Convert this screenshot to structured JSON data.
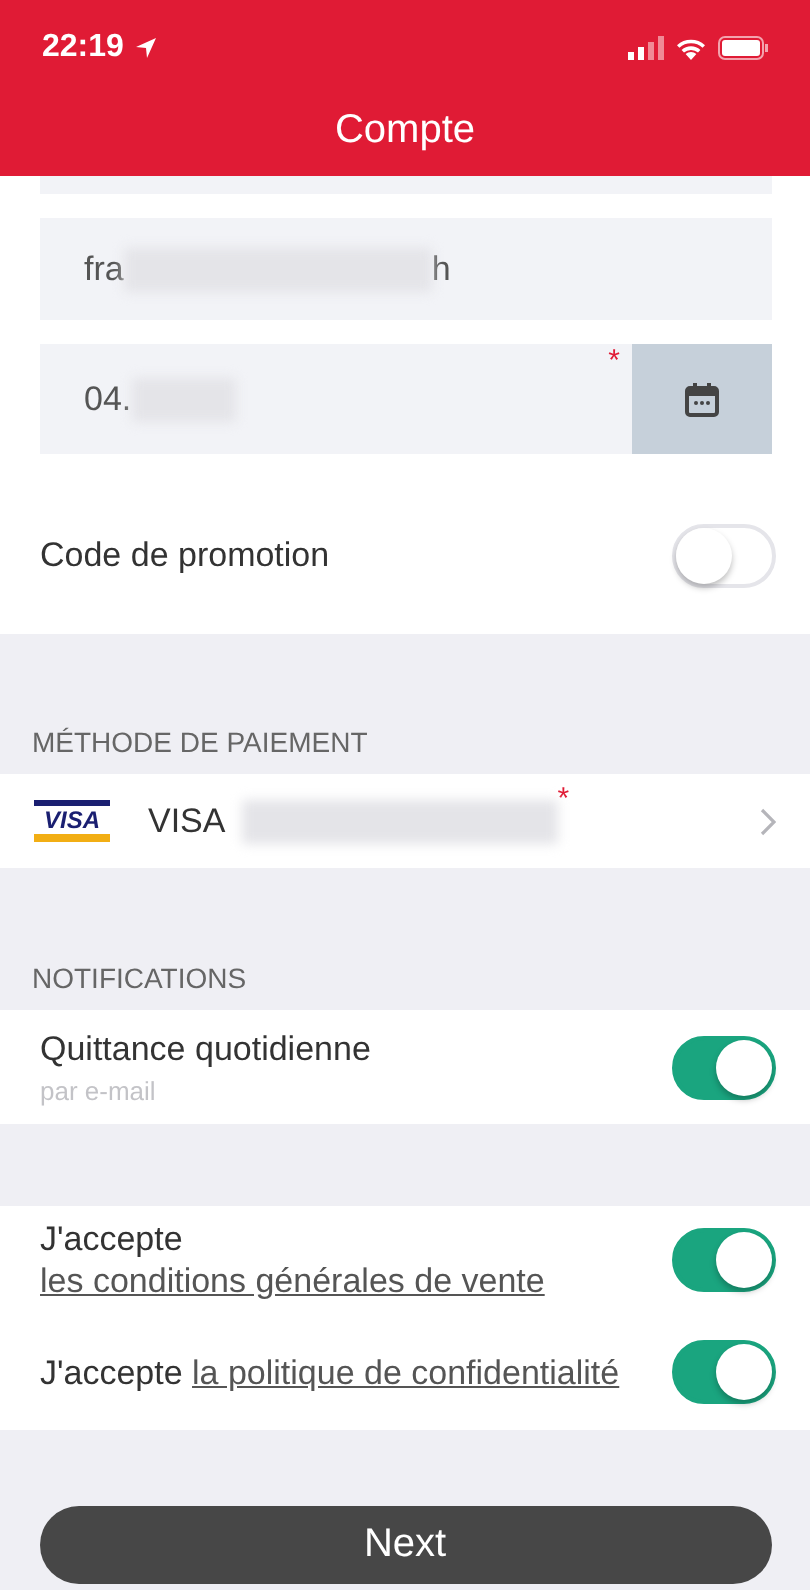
{
  "status_bar": {
    "time": "22:19"
  },
  "header": {
    "title": "Compte"
  },
  "fields": [
    {
      "kind": "text",
      "prefix": "fra",
      "suffix": "h"
    },
    {
      "kind": "date",
      "prefix": "04.",
      "required_mark": "*"
    }
  ],
  "promo": {
    "label": "Code de promotion",
    "on": false
  },
  "payment": {
    "header": "MÉTHODE DE PAIEMENT",
    "logo": "VISA",
    "label": "VISA",
    "required_mark": "*"
  },
  "notifications": {
    "header": "NOTIFICATIONS",
    "items": [
      {
        "label": "Quittance quotidienne",
        "sublabel": "par e-mail",
        "on": true
      }
    ]
  },
  "agreements": [
    {
      "text": "J'accepte ",
      "link": "les conditions générales de vente",
      "on": true
    },
    {
      "text": "J'accepte ",
      "link": "la politique de confidentialité",
      "on": true
    }
  ],
  "button": "Next"
}
